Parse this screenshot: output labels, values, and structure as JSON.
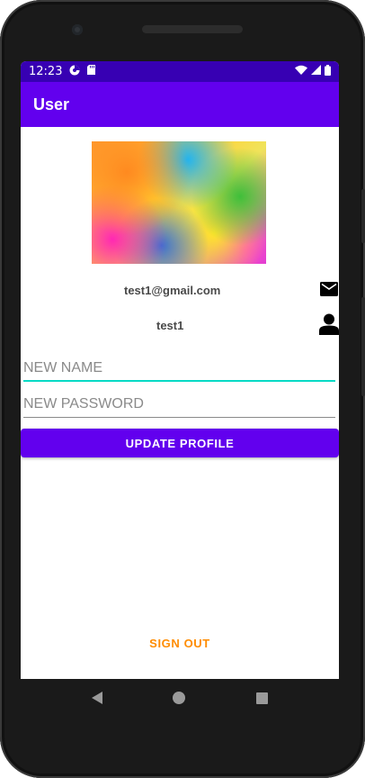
{
  "status_bar": {
    "time": "12:23",
    "icons": [
      "app-notification-icon",
      "sd-card-icon",
      "wifi-icon",
      "cellular-signal-icon",
      "battery-icon"
    ]
  },
  "app_bar": {
    "title": "User"
  },
  "profile": {
    "image_icon": "profile-image",
    "email": "test1@gmail.com",
    "email_icon": "mail-icon",
    "username": "test1",
    "username_icon": "person-icon"
  },
  "form": {
    "new_name_placeholder": "NEW NAME",
    "new_name_value": "",
    "new_password_placeholder": "NEW PASSWORD",
    "new_password_value": "",
    "update_label": "UPDATE PROFILE"
  },
  "footer": {
    "sign_out_label": "SIGN OUT"
  },
  "nav": {
    "icons": [
      "back-icon",
      "home-icon",
      "recents-icon"
    ]
  },
  "colors": {
    "status_bar": "#3700b3",
    "primary": "#6200ee",
    "accent_underline": "#03dac5",
    "sign_out": "#ff8c00"
  }
}
